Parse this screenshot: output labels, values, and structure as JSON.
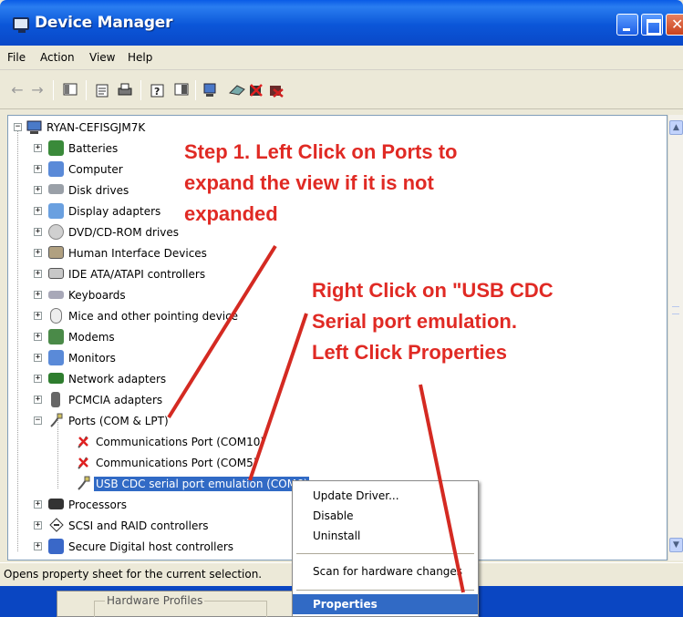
{
  "window": {
    "title": "Device Manager"
  },
  "menu": [
    "File",
    "Action",
    "View",
    "Help"
  ],
  "toolbar": {
    "icons": [
      "back-icon",
      "forward-icon",
      "console-tree-icon",
      "properties-icon",
      "print-icon",
      "help-icon",
      "view-icon",
      "scan-icon",
      "update-driver-icon",
      "disable-icon",
      "uninstall-icon"
    ]
  },
  "tree": {
    "root": "RYAN-CEFISGJM7K",
    "categories": [
      "Batteries",
      "Computer",
      "Disk drives",
      "Display adapters",
      "DVD/CD-ROM drives",
      "Human Interface Devices",
      "IDE ATA/ATAPI controllers",
      "Keyboards",
      "Mice and other pointing device",
      "Modems",
      "Monitors",
      "Network adapters",
      "PCMCIA adapters",
      "Ports (COM & LPT)"
    ],
    "ports_children": [
      "Communications Port (COM10)",
      "Communications Port (COM5)",
      "USB CDC serial port emulation (COM6)"
    ],
    "after": [
      "Processors",
      "SCSI and RAID controllers",
      "Secure Digital host controllers"
    ]
  },
  "context_menu": {
    "items": [
      "Update Driver...",
      "Disable",
      "Uninstall"
    ],
    "scan": "Scan for hardware changes",
    "properties": "Properties"
  },
  "status": "Opens property sheet for the current selection.",
  "behind": {
    "group_label": "Hardware Profiles"
  },
  "annotations": {
    "step1": [
      "Step 1. Left Click on Ports to",
      "expand the view if it is not",
      "expanded"
    ],
    "step2": [
      "Right Click on \"USB CDC",
      "Serial port emulation.",
      "Left Click Properties"
    ]
  },
  "colors": {
    "title_bar": "#0a5be6",
    "selection": "#316ac5",
    "annotation": "#e02a24"
  }
}
